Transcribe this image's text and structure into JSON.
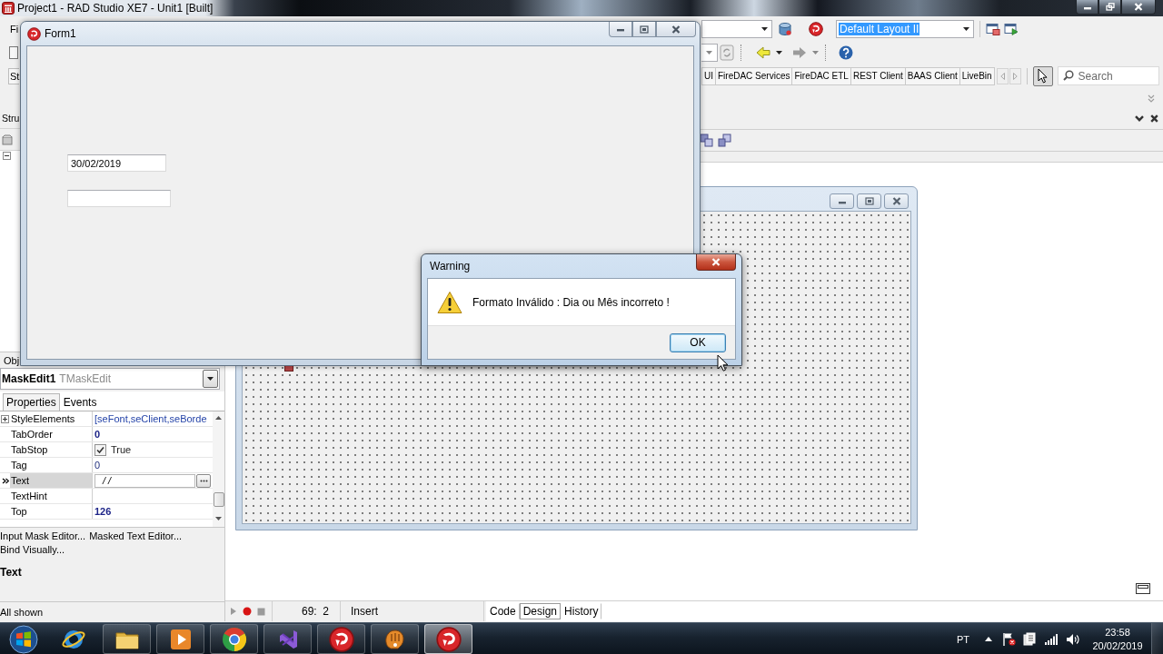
{
  "ide_window": {
    "title": "Project1 - RAD Studio XE7 - Unit1 [Built]"
  },
  "menu_bar": {
    "items": [
      "Fi"
    ]
  },
  "toolbar": {
    "layout_combo": {
      "value": "Default Layout II",
      "highlighted": true
    }
  },
  "palette": {
    "left_tab": "St",
    "tabs": [
      "UI",
      "FireDAC Services",
      "FireDAC ETL",
      "REST Client",
      "BAAS Client",
      "LiveBin"
    ],
    "pointer_selected": true,
    "search": {
      "placeholder": "Search"
    }
  },
  "structure_panel": {
    "title": "Stru",
    "root_expanded": true
  },
  "object_inspector": {
    "title": "Obj",
    "component": {
      "name": "MaskEdit1",
      "type": "TMaskEdit"
    },
    "tabs": [
      {
        "label": "Properties",
        "selected": true
      },
      {
        "label": "Events",
        "selected": false
      }
    ],
    "properties": [
      {
        "name": "StyleElements",
        "value": "[seFont,seClient,seBorde",
        "kind": "set",
        "expanded": false,
        "selected": false
      },
      {
        "name": "TabOrder",
        "value": "0",
        "kind": "changed",
        "selected": false
      },
      {
        "name": "TabStop",
        "value": "True",
        "kind": "check",
        "checked": true,
        "selected": false
      },
      {
        "name": "Tag",
        "value": "0",
        "kind": "default",
        "selected": false
      },
      {
        "name": "Text",
        "value": "/ /",
        "kind": "edit",
        "selected": true
      },
      {
        "name": "TextHint",
        "kind": "default",
        "selected": false
      },
      {
        "name": "Top",
        "value": "126",
        "kind": "changed",
        "selected": false
      }
    ],
    "links": [
      "Input Mask Editor...",
      "Masked Text Editor...",
      "Bind Visually..."
    ],
    "help_title": "Text",
    "status": "All shown"
  },
  "editor": {
    "status": {
      "position": "69:  2",
      "mode": "Insert"
    },
    "view_tabs": [
      {
        "label": "Code",
        "selected": false
      },
      {
        "label": "Design",
        "selected": true
      },
      {
        "label": "History",
        "selected": false
      }
    ]
  },
  "running_form": {
    "title": "Form1",
    "edits": [
      {
        "kind": "edit",
        "value": "30/02/2019"
      },
      {
        "kind": "edit"
      }
    ]
  },
  "warning_dialog": {
    "title": "Warning",
    "message": "Formato Inválido : Dia ou Mês incorreto !",
    "buttons": [
      {
        "label": "OK",
        "default": true
      }
    ]
  },
  "taskbar": {
    "apps": [
      {
        "running": false,
        "active": false
      },
      {
        "running": true,
        "active": false
      },
      {
        "running": true,
        "active": false
      },
      {
        "running": true,
        "active": false
      },
      {
        "running": true,
        "active": false
      },
      {
        "running": true,
        "active": false
      },
      {
        "running": true,
        "active": false
      },
      {
        "running": true,
        "active": true
      }
    ],
    "tray": {
      "language": "PT",
      "time": "23:58",
      "date": "20/02/2019"
    }
  }
}
